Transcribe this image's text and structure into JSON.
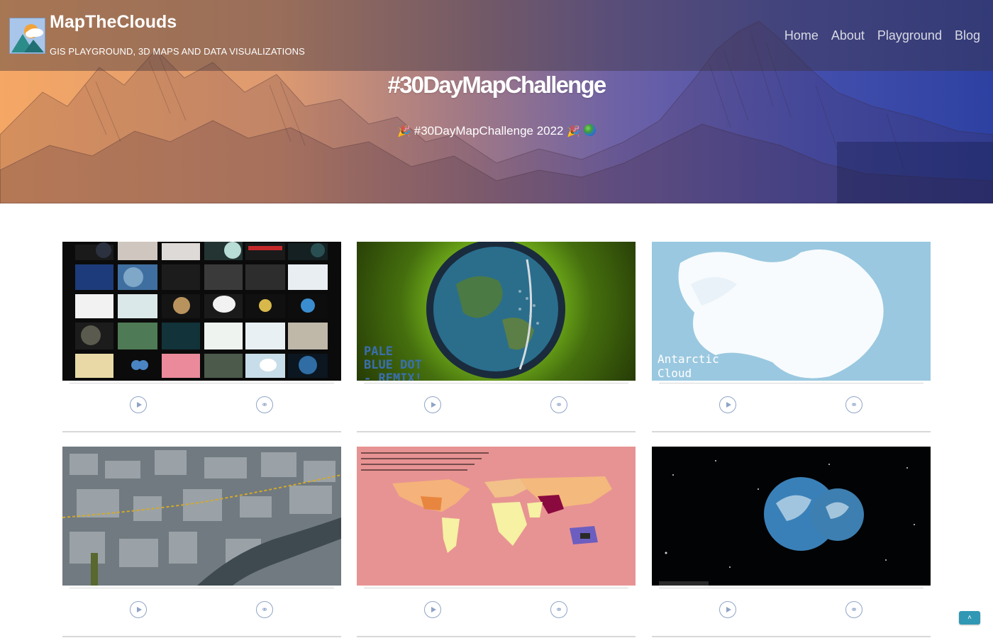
{
  "site": {
    "title": "MapTheClouds",
    "tagline": "GIS PLAYGROUND, 3D MAPS AND DATA VISUALIZATIONS"
  },
  "nav": {
    "items": [
      {
        "label": "Home"
      },
      {
        "label": "About"
      },
      {
        "label": "Playground"
      },
      {
        "label": "Blog"
      }
    ]
  },
  "hero": {
    "title": "#30DayMapChallenge",
    "subtitle": "#30DayMapChallenge 2022",
    "icons": [
      "party-popper-icon",
      "globe-icon"
    ]
  },
  "cards": [
    {
      "thumbnail": "map-grid-collage",
      "actions": [
        "play-icon",
        "link-icon"
      ]
    },
    {
      "thumbnail": "pale-blue-dot-globe",
      "overlay_text": [
        "PALE",
        "BLUE DOT",
        "- REMIX!"
      ],
      "actions": [
        "play-icon",
        "link-icon"
      ]
    },
    {
      "thumbnail": "antarctic-cloud",
      "overlay_text": [
        "Antarctic",
        "Cloud"
      ],
      "actions": [
        "play-icon",
        "link-icon"
      ]
    },
    {
      "thumbnail": "3d-city-aerial",
      "actions": [
        "play-icon",
        "link-icon"
      ]
    },
    {
      "thumbnail": "energy-world-map",
      "actions": [
        "play-icon",
        "link-icon"
      ]
    },
    {
      "thumbnail": "twin-earths",
      "actions": [
        "play-icon",
        "link-icon"
      ]
    }
  ],
  "back_to_top": {
    "label": "˄"
  },
  "colors": {
    "gradient_left": "#f5a765",
    "gradient_right": "#2d41a2",
    "action_icon": "#8fa4c6",
    "back_to_top": "#3097b4"
  }
}
